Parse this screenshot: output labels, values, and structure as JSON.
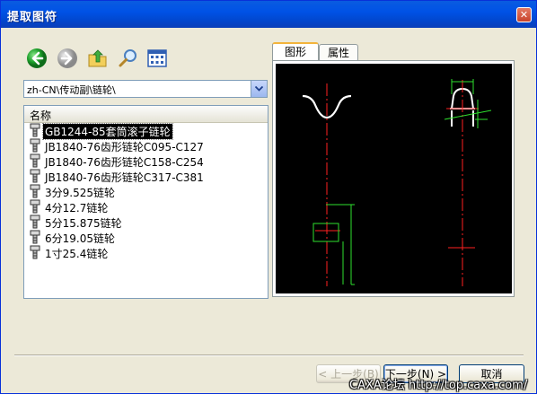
{
  "window": {
    "title": "提取图符",
    "close_glyph": "✕"
  },
  "toolbar": {
    "buttons": [
      {
        "name": "back-button",
        "icon": "arrow-left-icon"
      },
      {
        "name": "forward-button",
        "icon": "arrow-right-icon"
      },
      {
        "name": "up-folder-button",
        "icon": "folder-up-icon"
      },
      {
        "name": "search-button",
        "icon": "magnifier-icon"
      },
      {
        "name": "view-mode-button",
        "icon": "grid-view-icon"
      }
    ]
  },
  "path": {
    "value": "zh-CN\\传动副\\链轮\\"
  },
  "list": {
    "header": "名称",
    "items": [
      {
        "label": "GB1244-85套筒滚子链轮",
        "selected": true
      },
      {
        "label": "JB1840-76齿形链轮C095-C127",
        "selected": false
      },
      {
        "label": "JB1840-76齿形链轮C158-C254",
        "selected": false
      },
      {
        "label": "JB1840-76齿形链轮C317-C381",
        "selected": false
      },
      {
        "label": "3分9.525链轮",
        "selected": false
      },
      {
        "label": "4分12.7链轮",
        "selected": false
      },
      {
        "label": "5分15.875链轮",
        "selected": false
      },
      {
        "label": "6分19.05链轮",
        "selected": false
      },
      {
        "label": "1寸25.4链轮",
        "selected": false
      }
    ]
  },
  "tabs": [
    {
      "label": "图形",
      "active": true
    },
    {
      "label": "属性",
      "active": false
    }
  ],
  "preview": {
    "background": "#000000",
    "line_color": "#ffffff",
    "center_color": "#ff0000",
    "dim_color": "#00ff00"
  },
  "footer": {
    "prev_label": "< 上一步(B)",
    "next_label": "下一步(N) >",
    "cancel_label": "取消"
  },
  "watermark": "CAXA论坛 http://top.caxa.com/"
}
